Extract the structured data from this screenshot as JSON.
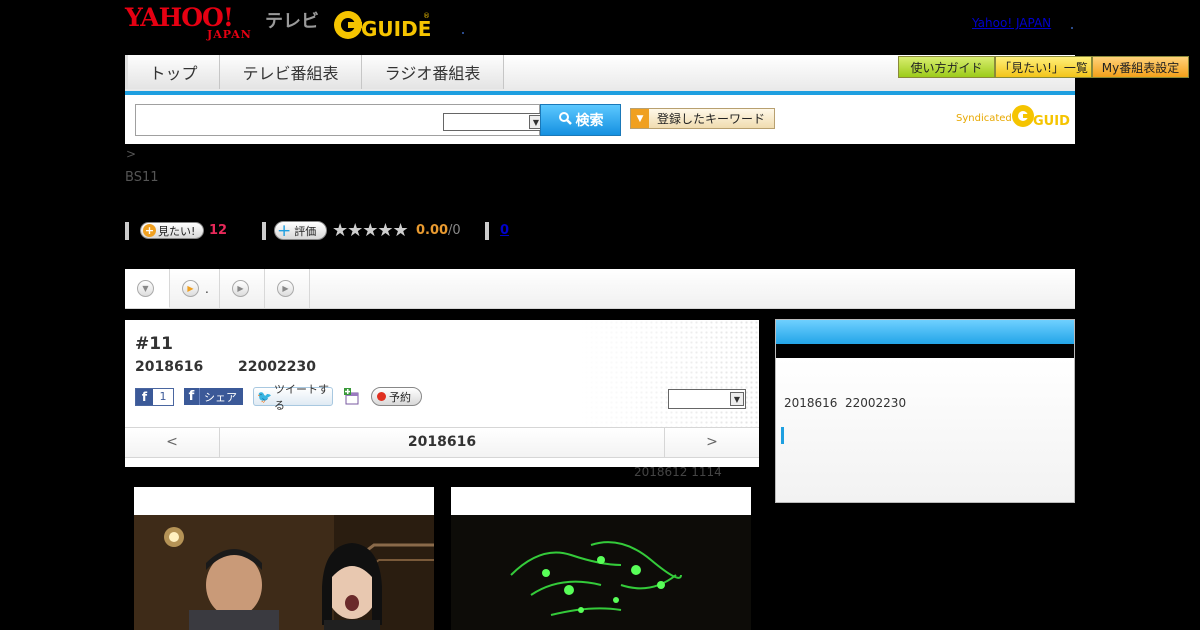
{
  "header": {
    "yahoo_logo": "YAHOO!",
    "japan_logo": "JAPAN",
    "tv_label": "テレビ",
    "gguide_logo": "G-GUIDE",
    "yahoo_japan_link": "Yahoo! JAPAN"
  },
  "nav": {
    "tabs": [
      {
        "label": "トップ"
      },
      {
        "label": "テレビ番組表"
      },
      {
        "label": "ラジオ番組表"
      }
    ],
    "util_buttons": [
      {
        "label": "使い方ガイド"
      },
      {
        "label": "「見たい!」一覧"
      },
      {
        "label": "My番組表設定"
      }
    ]
  },
  "search": {
    "input_value": "",
    "select_value": "",
    "button_label": "検索",
    "keyword_button_label": "登録したキーワード",
    "syndicated_label": "Syndicated"
  },
  "breadcrumb": ">",
  "channel": "BS11",
  "ratings": {
    "mitai_label": "見たい!",
    "mitai_count": "12",
    "hyoka_label": "評価",
    "stars": "★★★★★",
    "score": "0.00",
    "score_den": "/0",
    "review_count": "0"
  },
  "tabs": [
    {
      "icon": "chevron-down-icon"
    },
    {
      "icon": "play-icon",
      "label": "."
    },
    {
      "icon": "play-icon"
    },
    {
      "icon": "play-icon"
    }
  ],
  "program": {
    "title": "#11",
    "date": "2018616",
    "time": "22002230",
    "fb_like_count": "1",
    "fb_share_label": "シェア",
    "tweet_label": "ツイートする",
    "reserve_label": "予約",
    "select_value": "",
    "date_nav": {
      "prev": "<",
      "current": "2018616",
      "next": ">"
    },
    "updated": "2018612  1114"
  },
  "right_panel": {
    "date": "2018616",
    "time": "22002230"
  },
  "colors": {
    "accent_blue": "#1e9fe0",
    "mitai_pink": "#e8295a",
    "score_orange": "#e89a30"
  }
}
